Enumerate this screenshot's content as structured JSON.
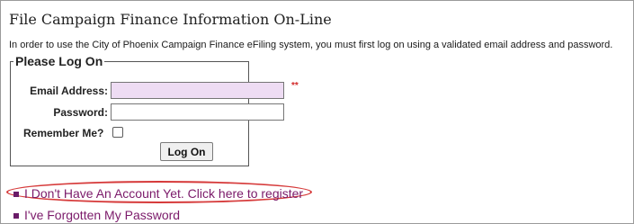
{
  "page": {
    "title": "File Campaign Finance Information On-Line",
    "intro": "In order to use the City of Phoenix Campaign Finance eFiling system, you must first log on using a validated email address and password."
  },
  "login": {
    "legend": "Please Log On",
    "email_label": "Email Address:",
    "email_value": "",
    "required_marker": "**",
    "password_label": "Password:",
    "password_value": "",
    "remember_label": "Remember Me?",
    "remember_checked": false,
    "submit_label": "Log On"
  },
  "links": [
    {
      "label": "I Don't Have An Account Yet. Click here to register"
    },
    {
      "label": "I've Forgotten My Password"
    }
  ],
  "colors": {
    "email_field_bg": "#eedcf3",
    "link": "#7b1a6a",
    "required": "#d22a2a",
    "highlight": "#d63a3a"
  }
}
